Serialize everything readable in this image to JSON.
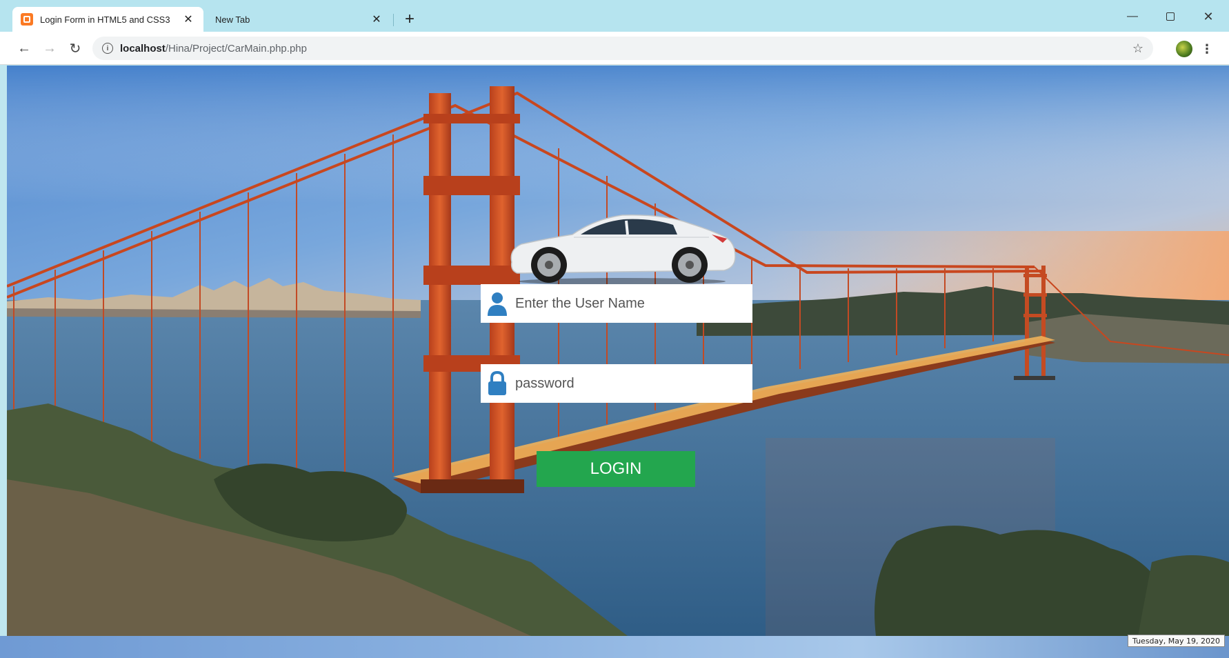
{
  "browser": {
    "tabs": [
      {
        "title": "Login Form in HTML5 and CSS3",
        "active": true
      },
      {
        "title": "New Tab",
        "active": false
      }
    ],
    "new_tab_icon": "plus-icon",
    "url_host": "localhost",
    "url_path": "/Hina/Project/CarMain.php.php",
    "window_controls": [
      "minimize-icon",
      "maximize-icon",
      "close-icon"
    ]
  },
  "login": {
    "username_placeholder": "Enter the User Name",
    "password_placeholder": "password",
    "button_label": "LOGIN",
    "button_color": "#23a64e",
    "icon_color": "#2f7fc1"
  },
  "footer": {
    "date": "Tuesday, May 19, 2020"
  }
}
